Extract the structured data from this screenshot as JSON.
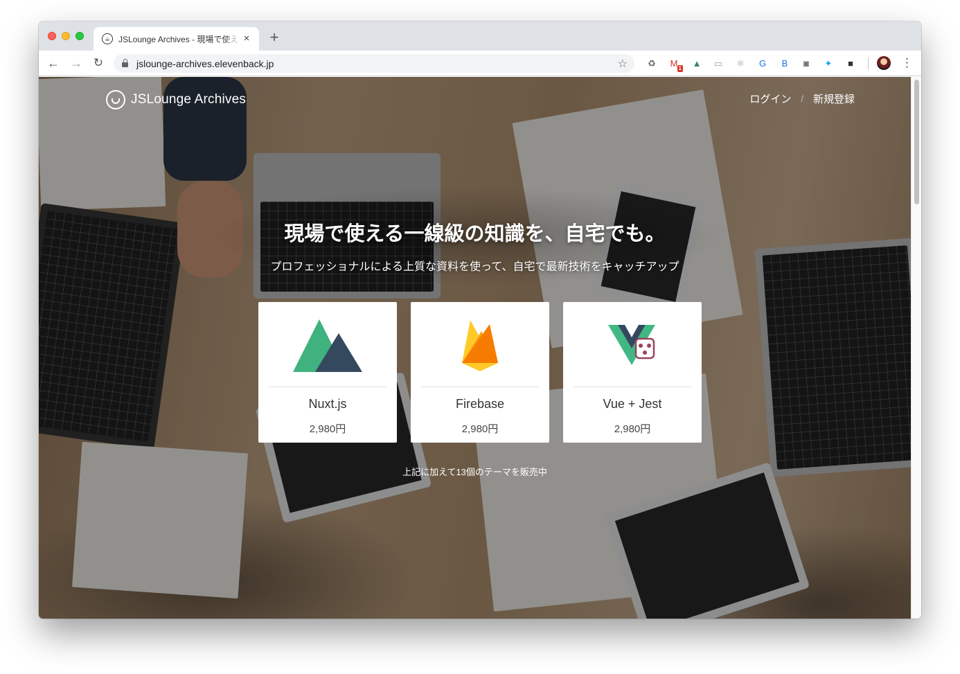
{
  "browser": {
    "tab": {
      "title": "JSLounge Archives - 現場で使える一線級の知識を、自宅でも。",
      "favicon": "cup-icon"
    },
    "url": "jslounge-archives.elevenback.jp",
    "extensions": [
      {
        "name": "recycle-icon",
        "glyph": "♻",
        "color": "#5f6368"
      },
      {
        "name": "gmail-icon",
        "glyph": "M",
        "color": "#d93025",
        "badge": "1"
      },
      {
        "name": "nuxt-ext-icon",
        "glyph": "▲",
        "color": "#3b8070"
      },
      {
        "name": "chat-ext-icon",
        "glyph": "▭",
        "color": "#9aa0a6"
      },
      {
        "name": "react-ext-icon",
        "glyph": "⚛",
        "color": "#9aa0a6"
      },
      {
        "name": "google-ext-icon",
        "glyph": "G",
        "color": "#1a73e8"
      },
      {
        "name": "b-ext-icon",
        "glyph": "B",
        "color": "#1a73e8"
      },
      {
        "name": "camera-icon",
        "glyph": "◙",
        "color": "#5f6368"
      },
      {
        "name": "twitter-icon",
        "glyph": "✦",
        "color": "#1da1f2"
      },
      {
        "name": "video-camera-icon",
        "glyph": "■",
        "color": "#333333"
      }
    ]
  },
  "site": {
    "brand": "JSLounge Archives",
    "nav": {
      "login": "ログイン",
      "separator": "/",
      "signup": "新規登録"
    },
    "hero": {
      "title": "現場で使える一線級の知識を、自宅でも。",
      "subtitle": "プロフェッショナルによる上質な資料を使って、自宅で最新技術をキャッチアップ"
    },
    "cards": [
      {
        "name": "Nuxt.js",
        "price": "2,980円",
        "logo": "nuxt-logo-icon"
      },
      {
        "name": "Firebase",
        "price": "2,980円",
        "logo": "firebase-logo-icon"
      },
      {
        "name": "Vue + Jest",
        "price": "2,980円",
        "logo": "vue-jest-logo-icon"
      }
    ],
    "footer_note": "上記に加えて13個のテーマを販売中"
  },
  "colors": {
    "nuxt_green": "#3fb27f",
    "nuxt_dark": "#35495e",
    "firebase_orange": "#ffa000",
    "firebase_yellow": "#ffca28",
    "jest_red": "#99425b"
  }
}
